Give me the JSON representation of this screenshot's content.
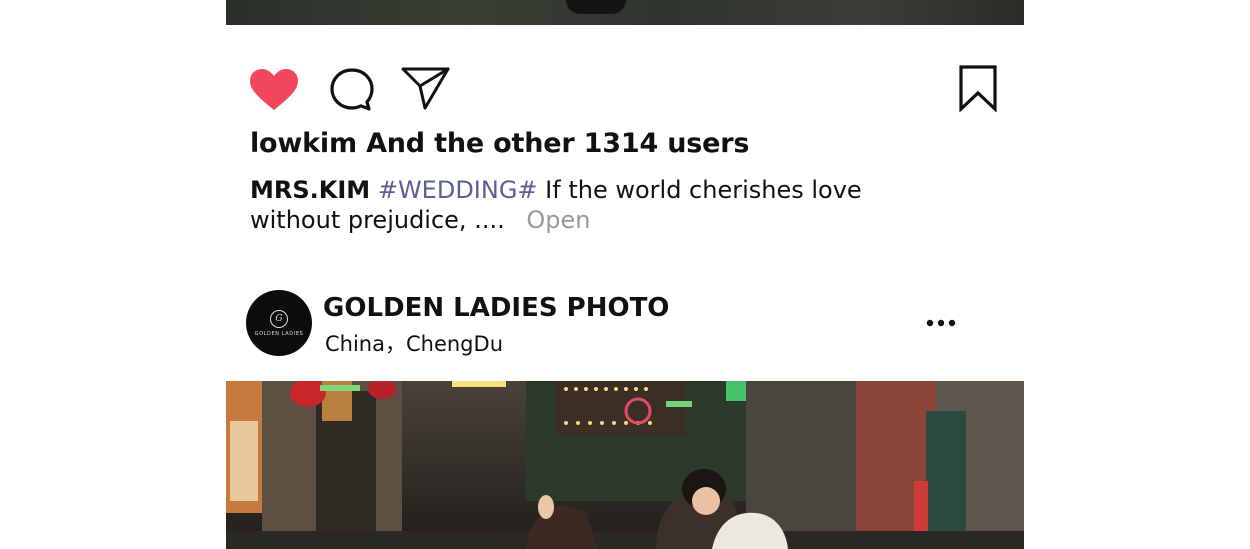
{
  "post_top": {
    "actions": {
      "like_icon": "heart-icon-filled",
      "comment_icon": "comment-bubble-icon",
      "share_icon": "paper-plane-icon",
      "save_icon": "bookmark-icon"
    },
    "likes_text": "lowkim And the other 1314 users",
    "caption": {
      "author": "MRS.KIM",
      "hashtag": "#WEDDING#",
      "text": "If the world cherishes love without prejudice, ....",
      "more": "Open"
    }
  },
  "next_post": {
    "avatar_logo_text": "GOLDEN LADIES",
    "account_name": "GOLDEN LADIES PHOTO",
    "location": "China，ChengDu",
    "more_icon": "ellipsis-icon"
  },
  "colors": {
    "like_red": "#f0475e",
    "hashtag": "#5a5f95",
    "muted": "#9a9a9a"
  }
}
